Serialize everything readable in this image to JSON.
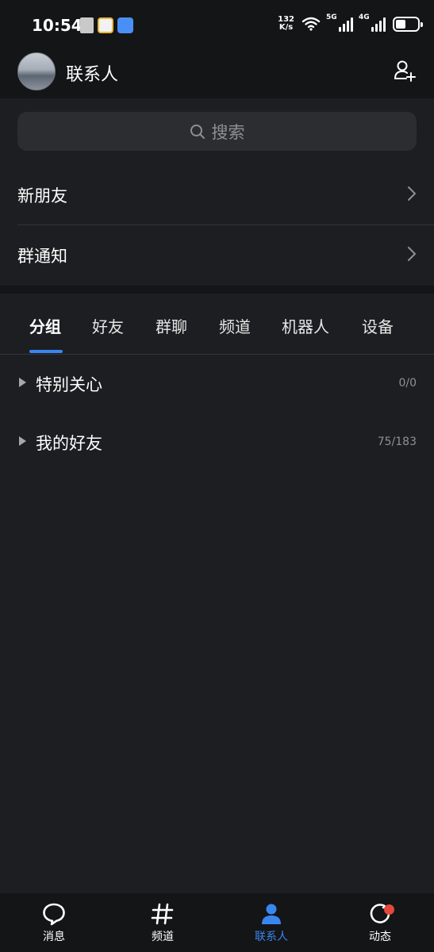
{
  "status_bar": {
    "time": "10:54",
    "net_speed_value": "132",
    "net_speed_unit": "K/s",
    "signal_1": "5G",
    "signal_2": "4G"
  },
  "header": {
    "title": "联系人"
  },
  "search": {
    "placeholder": "搜索"
  },
  "entries": [
    {
      "label": "新朋友"
    },
    {
      "label": "群通知"
    }
  ],
  "tabs": [
    {
      "label": "分组",
      "active": true
    },
    {
      "label": "好友"
    },
    {
      "label": "群聊"
    },
    {
      "label": "频道"
    },
    {
      "label": "机器人"
    },
    {
      "label": "设备"
    }
  ],
  "groups": [
    {
      "name": "特别关心",
      "count": "0/0"
    },
    {
      "name": "我的好友",
      "count": "75/183"
    }
  ],
  "bottom_nav": [
    {
      "label": "消息",
      "icon": "message-bubble-icon"
    },
    {
      "label": "频道",
      "icon": "hash-icon"
    },
    {
      "label": "联系人",
      "icon": "contacts-person-icon",
      "active": true
    },
    {
      "label": "动态",
      "icon": "refresh-circle-icon",
      "badge": "red-dot"
    }
  ],
  "colors": {
    "accent": "#3a86f0",
    "background": "#1d1e21",
    "bar_background": "#141517",
    "badge": "#e5483b"
  }
}
